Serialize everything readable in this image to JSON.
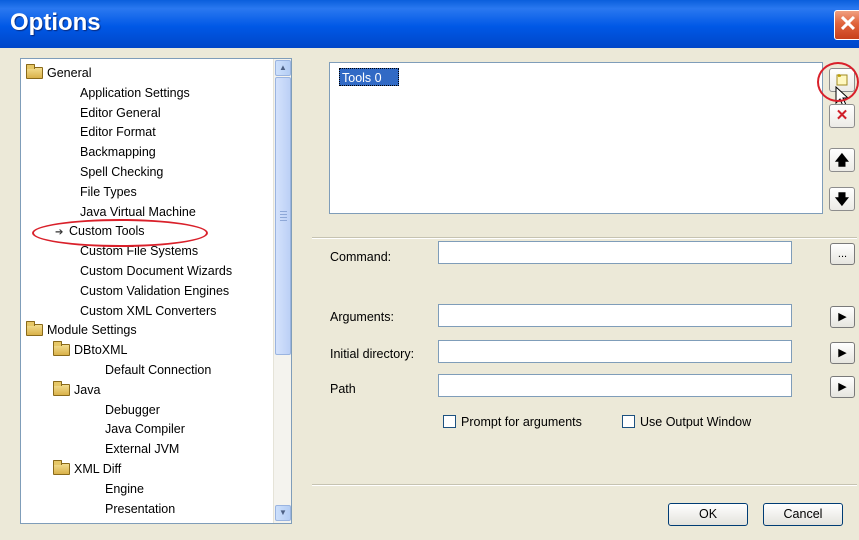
{
  "window": {
    "title": "Options",
    "close_glyph": "✕"
  },
  "tree": {
    "items": [
      {
        "label": "General",
        "icon": "folder-icon",
        "level": 0
      },
      {
        "label": "Application Settings",
        "level": 1
      },
      {
        "label": "Editor General",
        "level": 1
      },
      {
        "label": "Editor Format",
        "level": 1
      },
      {
        "label": "Backmapping",
        "level": 1
      },
      {
        "label": "Spell Checking",
        "level": 1
      },
      {
        "label": "File Types",
        "level": 1
      },
      {
        "label": "Java Virtual Machine",
        "level": 1
      },
      {
        "label": "Custom Tools",
        "level": 1,
        "selected": true
      },
      {
        "label": "Custom File Systems",
        "level": 1
      },
      {
        "label": "Custom Document Wizards",
        "level": 1
      },
      {
        "label": "Custom Validation Engines",
        "level": 1
      },
      {
        "label": "Custom XML Converters",
        "level": 1
      },
      {
        "label": "Module Settings",
        "icon": "folder-icon",
        "level": 0
      },
      {
        "label": "DBtoXML",
        "icon": "folder-icon",
        "level": 1
      },
      {
        "label": "Default Connection",
        "level": 2
      },
      {
        "label": "Java",
        "icon": "folder-icon",
        "level": 1
      },
      {
        "label": "Debugger",
        "level": 2
      },
      {
        "label": "Java Compiler",
        "level": 2
      },
      {
        "label": "External JVM",
        "level": 2
      },
      {
        "label": "XML Diff",
        "icon": "folder-icon",
        "level": 1
      },
      {
        "label": "Engine",
        "level": 2
      },
      {
        "label": "Presentation",
        "level": 2
      }
    ],
    "scroll_up": "▲",
    "scroll_down": "▼"
  },
  "tools_list": {
    "items": [
      "Tools 0"
    ]
  },
  "side_buttons": {
    "new_icon": "new-tool-icon",
    "delete_glyph": "✕",
    "up_glyph": "🡅",
    "down_glyph": "🡇"
  },
  "form": {
    "command_label": "Command:",
    "command_value": "",
    "arguments_label": "Arguments:",
    "arguments_value": "",
    "initial_dir_label": "Initial directory:",
    "initial_dir_value": "",
    "path_label": "Path",
    "path_value": "",
    "browse_label": "...",
    "arrow_glyph": "▶",
    "prompt_label": "Prompt for arguments",
    "output_label": "Use Output Window"
  },
  "dialog": {
    "ok_label": "OK",
    "cancel_label": "Cancel"
  },
  "colors": {
    "titlebar": "#0058e6",
    "selection": "#316ac5",
    "annotation": "#d9202a"
  }
}
